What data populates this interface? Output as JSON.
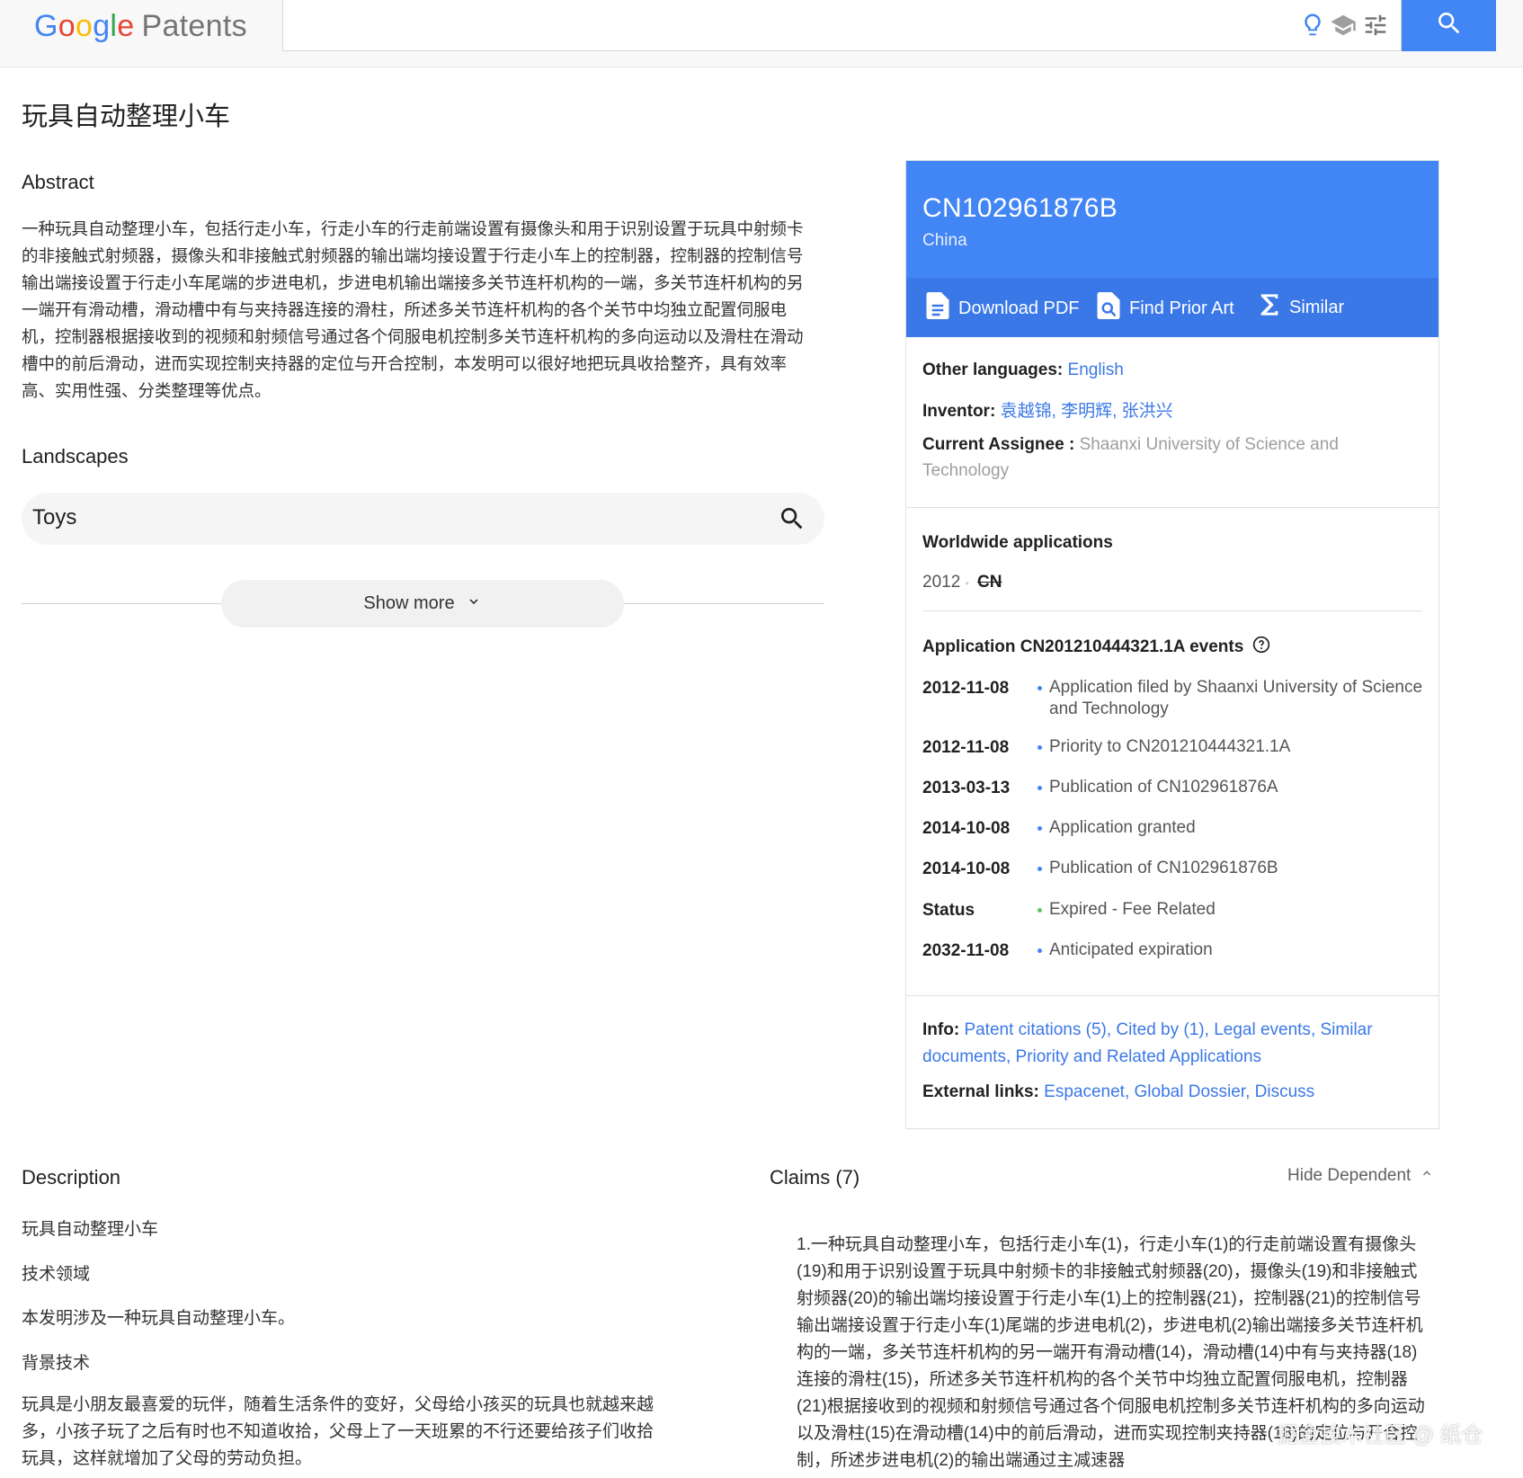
{
  "header": {
    "logo_google": [
      "G",
      "o",
      "o",
      "g",
      "l",
      "e"
    ],
    "logo_product": "Patents",
    "search_value": "",
    "icons": [
      "lightbulb-icon",
      "graduation-cap-icon",
      "tune-icon",
      "search-icon"
    ]
  },
  "page": {
    "title": "玩具自动整理小车"
  },
  "abstract": {
    "heading": "Abstract",
    "text": "一种玩具自动整理小车，包括行走小车，行走小车的行走前端设置有摄像头和用于识别设置于玩具中射频卡的非接触式射频器，摄像头和非接触式射频器的输出端均接设置于行走小车上的控制器，控制器的控制信号输出端接设置于行走小车尾端的步进电机，步进电机输出端接多关节连杆机构的一端，多关节连杆机构的另一端开有滑动槽，滑动槽中有与夹持器连接的滑柱，所述多关节连杆机构的各个关节中均独立配置伺服电机，控制器根据接收到的视频和射频信号通过各个伺服电机控制多关节连杆机构的多向运动以及滑柱在滑动槽中的前后滑动，进而实现控制夹持器的定位与开合控制，本发明可以很好地把玩具收拾整齐，具有效率高、实用性强、分类整理等优点。"
  },
  "landscapes": {
    "heading": "Landscapes",
    "item": "Toys",
    "show_more": "Show more"
  },
  "card": {
    "pub_number": "CN102961876B",
    "country": "China",
    "actions": {
      "download": "Download PDF",
      "prior_art": "Find Prior Art",
      "similar": "Similar"
    },
    "other_languages_label": "Other languages:",
    "other_languages_value": "English",
    "inventor_label": "Inventor:",
    "inventors": "袁越锦, 李明辉, 张洪兴",
    "assignee_label": "Current Assignee :",
    "assignee_line1": "Shaanxi University of Science and",
    "assignee_line2": "Technology",
    "worldwide_title": "Worldwide applications",
    "worldwide_year": "2012",
    "worldwide_dot": "•",
    "worldwide_country": "CN",
    "events_title": "Application CN201210444321.1A events",
    "events": [
      {
        "date": "2012-11-08",
        "text": "Application filed by Shaanxi University of Science and Technology"
      },
      {
        "date": "2012-11-08",
        "text": "Priority to CN201210444321.1A"
      },
      {
        "date": "2013-03-13",
        "text": "Publication of CN102961876A"
      },
      {
        "date": "2014-10-08",
        "text": "Application granted"
      },
      {
        "date": "2014-10-08",
        "text": "Publication of CN102961876B"
      },
      {
        "date": "Status",
        "text": "Expired - Fee Related"
      },
      {
        "date": "2032-11-08",
        "text": "Anticipated expiration"
      }
    ],
    "status_color": "#61c561",
    "accent_color": "#4285f4",
    "info_label": "Info:",
    "info_links": [
      "Patent citations (5)",
      "Cited by (1)",
      "Legal events",
      "Similar documents",
      "Priority and Related Applications"
    ],
    "external_label": "External links:",
    "external_links": [
      "Espacenet",
      "Global Dossier",
      "Discuss"
    ]
  },
  "description": {
    "heading": "Description",
    "paragraphs": [
      "玩具自动整理小车",
      "技术领域",
      "本发明涉及一种玩具自动整理小车。",
      "背景技术"
    ],
    "long_text": "玩具是小朋友最喜爱的玩伴，随着生活条件的变好，父母给小孩买的玩具也就越来越多，小孩子玩了之后有时也不知道收拾，父母上了一天班累的不行还要给孩子们收拾玩具，这样就增加了父母的劳动负担。"
  },
  "claims": {
    "heading": "Claims (7)",
    "hide_dependent": "Hide Dependent",
    "text": "1.一种玩具自动整理小车，包括行走小车(1)，行走小车(1)的行走前端设置有摄像头(19)和用于识别设置于玩具中射频卡的非接触式射频器(20)，摄像头(19)和非接触式射频器(20)的输出端均接设置于行走小车(1)上的控制器(21)，控制器(21)的控制信号输出端接设置于行走小车(1)尾端的步进电机(2)，步进电机(2)输出端接多关节连杆机构的一端，多关节连杆机构的另一端开有滑动槽(14)，滑动槽(14)中有与夹持器(18)连接的滑柱(15)，所述多关节连杆机构的各个关节中均独立配置伺服电机，控制器(21)根据接收到的视频和射频信号通过各个伺服电机控制多关节连杆机构的多向运动以及滑柱(15)在滑动槽(14)中的前后滑动，进而实现控制夹持器(18)的定位与开合控制，所述步进电机(2)的输出端通过主减速器"
  },
  "watermark": "掘金技术社区 @ 纸仓"
}
